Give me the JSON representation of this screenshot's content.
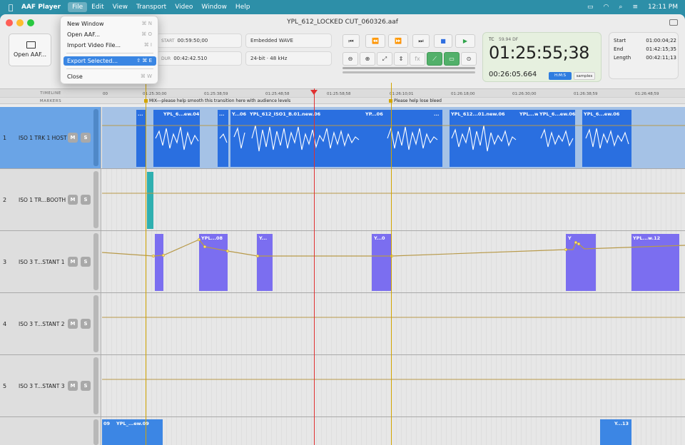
{
  "menubar": {
    "app": "AAF Player",
    "items": [
      "File",
      "Edit",
      "View",
      "Transport",
      "Video",
      "Window",
      "Help"
    ],
    "time": "12:11 PM"
  },
  "window": {
    "title": "YPL_612_LOCKED CUT_060326.aaf"
  },
  "toolbar": {
    "open_label": "Open AAF...",
    "start_label": "START",
    "start_value": "00:59:50;00",
    "dur_label": "DUR",
    "dur_value": "00:42:42.510",
    "format": "Embedded WAVE",
    "sample": "24-bit · 48 kHz",
    "fx_label": "fx"
  },
  "timecode": {
    "label": "TC",
    "rate": "59.94 DF",
    "main": "01:25:55;38",
    "sub": "00:26:05.664",
    "mode_active": "H:M:S",
    "mode_other": "samples"
  },
  "range": {
    "start_label": "Start",
    "start": "01:00:04;22",
    "end_label": "End",
    "end": "01:42:15;35",
    "length_label": "Length",
    "length": "00:42:11;13"
  },
  "file_menu": {
    "items": [
      {
        "label": "New Window",
        "shortcut": "⌘ N"
      },
      {
        "label": "Open AAF...",
        "shortcut": "⌘ O"
      },
      {
        "label": "Import Video File...",
        "shortcut": "⌘ I"
      },
      {
        "label": "Export Selected...",
        "shortcut": "⇧ ⌘ E"
      },
      {
        "label": "Close",
        "shortcut": "⌘ W"
      }
    ]
  },
  "timeline": {
    "ruler_label": "TIMELINE",
    "markers_label": "MARKERS",
    "ticks": [
      "00",
      "01:25:30;00",
      "01:25:38;59",
      "01:25:48;58",
      "01:25:58;58",
      "01:26:10;01",
      "01:26:18;00",
      "01:26:30;00",
      "01:26:38;59",
      "01:26:48;59"
    ],
    "marker_texts": [
      "MIX---please help smooth this transition here with audience levels",
      "Please help lose bleed"
    ]
  },
  "tracks": [
    {
      "num": "1",
      "name": "ISO 1 TRK 1 HOST",
      "mute": "M",
      "solo": "S"
    },
    {
      "num": "2",
      "name": "ISO 1 TR...BOOTH",
      "mute": "M",
      "solo": "S"
    },
    {
      "num": "3",
      "name": "ISO 3 T...STANT 1",
      "mute": "M",
      "solo": "S"
    },
    {
      "num": "4",
      "name": "ISO 3 T...STANT 2",
      "mute": "M",
      "solo": "S"
    },
    {
      "num": "5",
      "name": "ISO 3 T...STANT 3",
      "mute": "M",
      "solo": "S"
    }
  ],
  "clips": {
    "t1": [
      "...",
      "YPL_6...ew.04",
      "...",
      "Y...06",
      "YPL_612_ISO1_B.01.new.06",
      "YP...06",
      "...",
      "YPL_612...01.new.06",
      "YPL...w.06",
      "YPL_6...ew.06",
      "YPL_6...ew.06"
    ],
    "t3": [
      "YPL...08",
      "Y...",
      "Y...0",
      "Y",
      "YPL...w.12",
      "Y..."
    ],
    "t6": [
      "09",
      "YPL_...ew.09",
      "Y...13"
    ]
  },
  "colors": {
    "selected_track": "#6aa4e6",
    "audio_clip": "#2a6fe0",
    "automation_clip": "#7b6ef0",
    "playhead": "#e03030",
    "marker_line": "#d2a500"
  }
}
